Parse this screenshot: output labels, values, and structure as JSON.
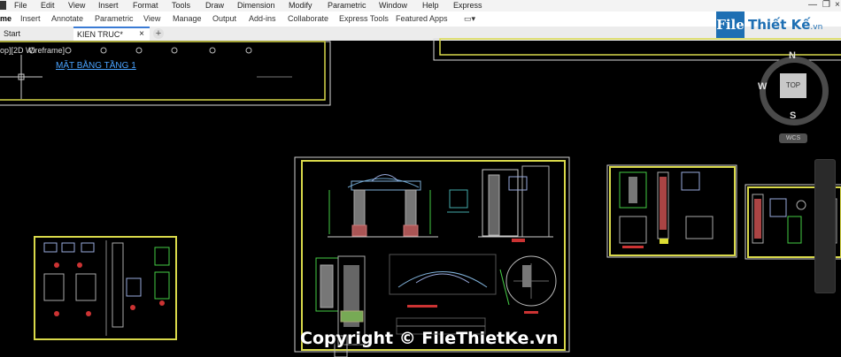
{
  "menu": [
    "File",
    "Edit",
    "View",
    "Insert",
    "Format",
    "Tools",
    "Draw",
    "Dimension",
    "Modify",
    "Parametric",
    "Window",
    "Help",
    "Express"
  ],
  "ribbon": {
    "home": "me",
    "tabs": [
      "Insert",
      "Annotate",
      "Parametric",
      "View",
      "Manage",
      "Output",
      "Add-ins",
      "Collaborate",
      "Express Tools",
      "Featured Apps"
    ]
  },
  "doc_tabs": {
    "start": "Start",
    "active": "KIEN TRUC*",
    "close": "×",
    "new_tab": "+"
  },
  "viewport": {
    "label": "op][2D Wireframe]",
    "sheet_title": "MẶT BẰNG TẦNG 1"
  },
  "viewcube": {
    "top": "TOP",
    "north": "N",
    "south": "S",
    "west": "W",
    "wcs": "WCS"
  },
  "logo": {
    "box": "File",
    "name": "Thiết Kế",
    "domain": ".vn"
  },
  "copyright": "Copyright © FileThietKe.vn",
  "colors": {
    "canvas": "#000000",
    "frame": "#d9d94a",
    "accent": "#3a7bd5",
    "logo": "#1e6fb3"
  }
}
